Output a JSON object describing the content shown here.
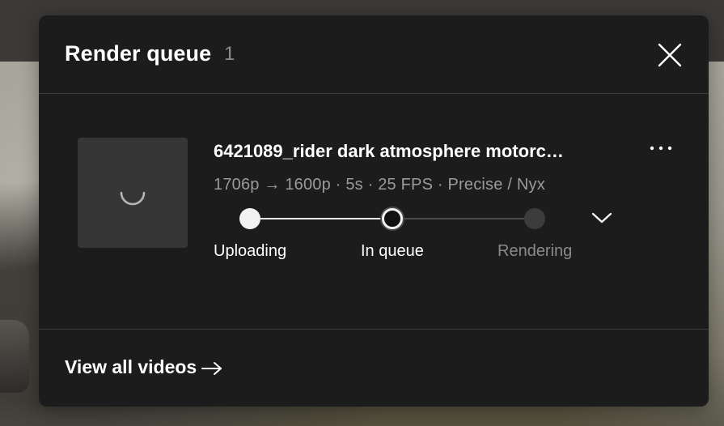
{
  "render_queue": {
    "title": "Render queue",
    "count": "1"
  },
  "job": {
    "filename": "6421089_rider dark atmosphere motorc…",
    "meta": "1706p → 1600p · 5s · 25 FPS · Precise / Nyx",
    "steps": [
      {
        "label": "Uploading",
        "state": "done"
      },
      {
        "label": "In queue",
        "state": "current"
      },
      {
        "label": "Rendering",
        "state": "pending"
      }
    ]
  },
  "footer": {
    "view_all_label": "View all videos"
  },
  "icons": {
    "close": "close-icon",
    "more": "more-horizontal-icon",
    "expand": "chevron-down-icon",
    "spinner": "loading-spinner-icon",
    "arrow": "arrow-right-icon"
  },
  "colors": {
    "panel_bg": "#1c1c1c",
    "thumb_bg": "#363636",
    "text_primary": "#ffffff",
    "text_secondary": "#9a9a9a",
    "divider": "#3a3a3a"
  }
}
